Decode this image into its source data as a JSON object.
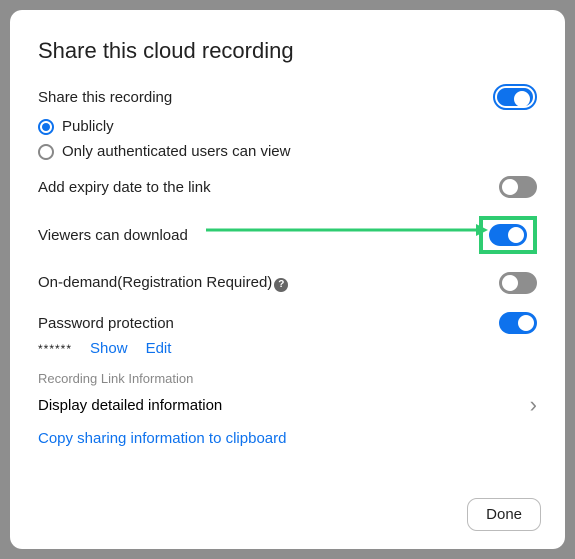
{
  "dialog": {
    "title": "Share this cloud recording",
    "share_label": "Share this recording",
    "radio": {
      "public": "Publicly",
      "auth": "Only authenticated users can view"
    },
    "expiry_label": "Add expiry date to the link",
    "download_label": "Viewers can download",
    "ondemand_label": "On-demand(Registration Required)",
    "password_label": "Password protection",
    "password_mask": "******",
    "show_label": "Show",
    "edit_label": "Edit",
    "section_label": "Recording Link Information",
    "detail_label": "Display detailed information",
    "copy_label": "Copy sharing information to clipboard",
    "done_label": "Done"
  }
}
